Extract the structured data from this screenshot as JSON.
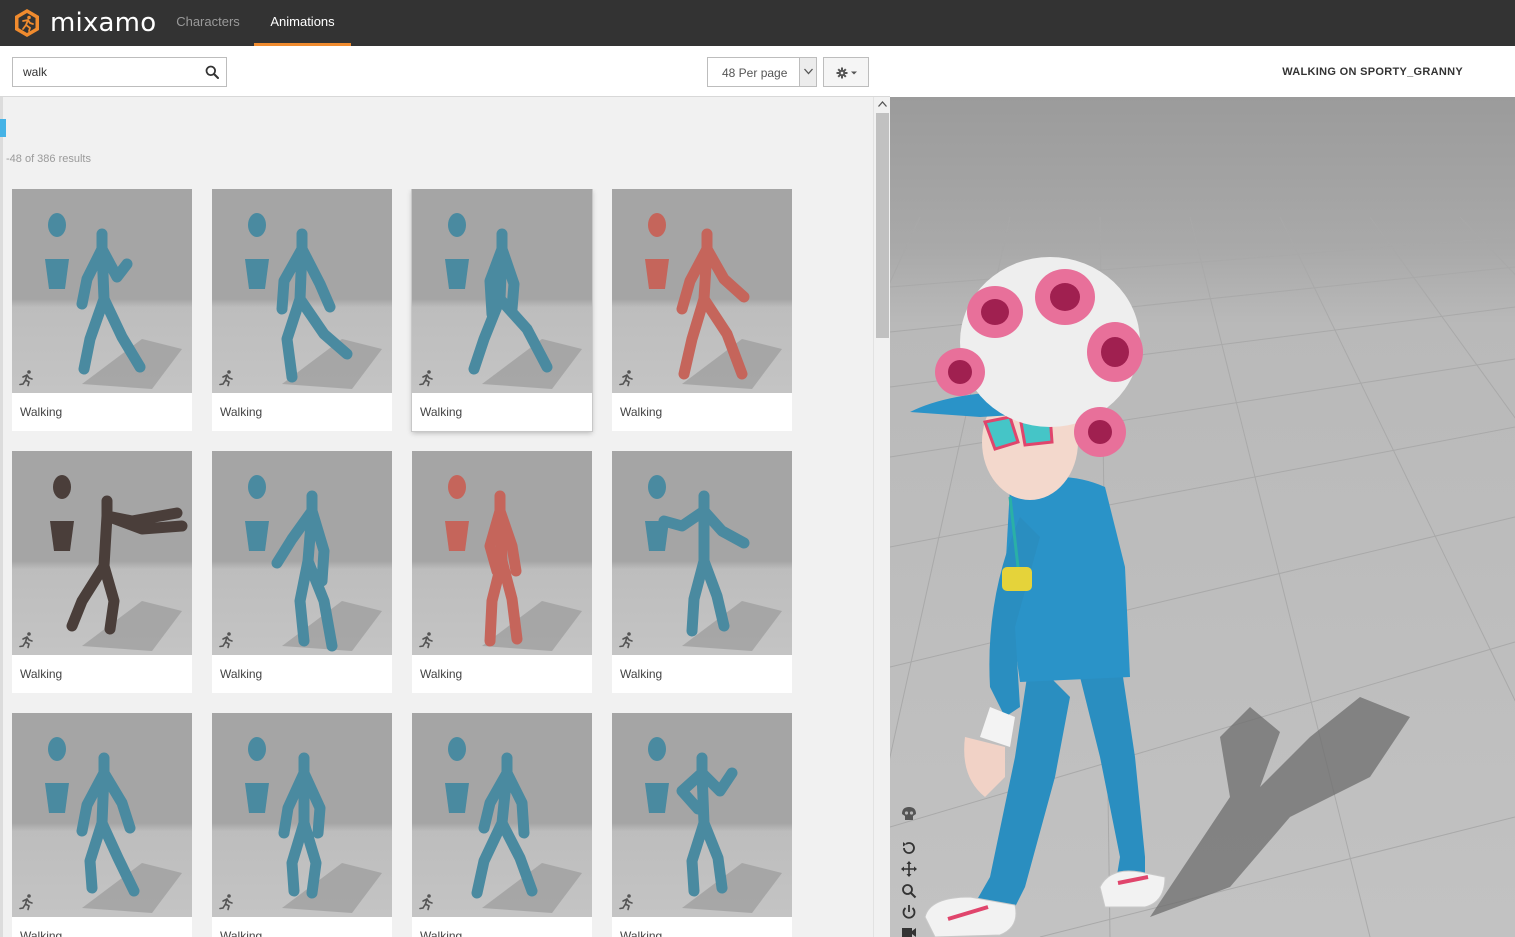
{
  "app": {
    "name": "mixamo"
  },
  "nav": {
    "tabs": [
      {
        "label": "Characters"
      },
      {
        "label": "Animations"
      }
    ],
    "active": "Animations"
  },
  "search": {
    "value": "walk"
  },
  "per_page": {
    "label": "48 Per page"
  },
  "results": {
    "text": "-48 of 386 results"
  },
  "cards": [
    {
      "label": "Walking",
      "figure_color": "#4a8aa0",
      "selected": false
    },
    {
      "label": "Walking",
      "figure_color": "#4a8aa0",
      "selected": false
    },
    {
      "label": "Walking",
      "figure_color": "#4a8aa0",
      "selected": true
    },
    {
      "label": "Walking",
      "figure_color": "#c5655b",
      "selected": false
    },
    {
      "label": "Walking",
      "figure_color": "#4a3e3a",
      "selected": false
    },
    {
      "label": "Walking",
      "figure_color": "#4a8aa0",
      "selected": false
    },
    {
      "label": "Walking",
      "figure_color": "#c5655b",
      "selected": false
    },
    {
      "label": "Walking",
      "figure_color": "#4a8aa0",
      "selected": false
    },
    {
      "label": "Walking",
      "figure_color": "#4a8aa0",
      "selected": false
    },
    {
      "label": "Walking",
      "figure_color": "#4a8aa0",
      "selected": false
    },
    {
      "label": "Walking",
      "figure_color": "#4a8aa0",
      "selected": false
    },
    {
      "label": "Walking",
      "figure_color": "#4a8aa0",
      "selected": false
    }
  ],
  "viewer": {
    "title": "WALKING ON SPORTY_GRANNY",
    "tools": [
      "skull-icon",
      "reset-icon",
      "move-icon",
      "zoom-icon",
      "power-icon",
      "camera-icon"
    ]
  },
  "colors": {
    "accent": "#f08b2e",
    "topbar": "#333333",
    "select_blue": "#46b3e6"
  }
}
